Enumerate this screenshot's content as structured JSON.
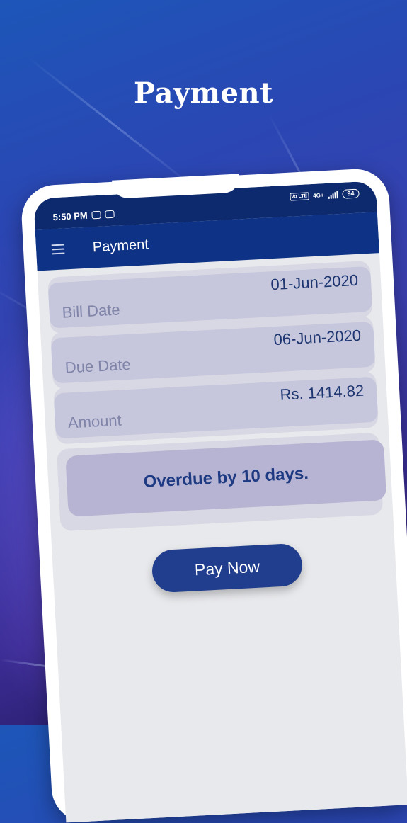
{
  "hero": {
    "title": "Payment"
  },
  "status_bar": {
    "time": "5:50 PM",
    "network": "4G+",
    "volte": "Vo LTE",
    "battery": "94"
  },
  "app_bar": {
    "title": "Payment",
    "menu_icon": "hamburger-menu-icon"
  },
  "fields": [
    {
      "label": "Bill Date",
      "value": "01-Jun-2020"
    },
    {
      "label": "Due Date",
      "value": "06-Jun-2020"
    },
    {
      "label": "Amount",
      "value": "Rs. 1414.82"
    }
  ],
  "overdue": {
    "text": "Overdue by 10 days."
  },
  "actions": {
    "pay_now": "Pay Now"
  },
  "colors": {
    "app_bar": "#0e3386",
    "button": "#213d8d",
    "overdue_text": "#1d3a82"
  }
}
